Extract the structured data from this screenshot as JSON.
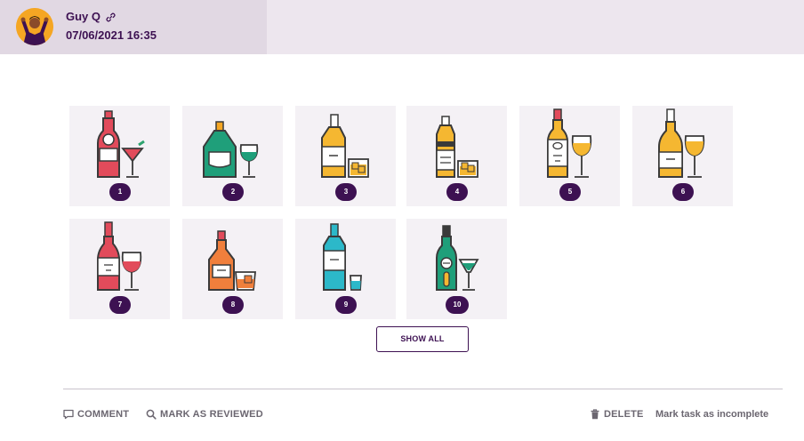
{
  "post": {
    "author": "Guy Q",
    "timestamp": "07/06/2021 16:35"
  },
  "gallery": {
    "items": [
      {
        "number": "1",
        "icon": "red-bottle-with-cocktail-glass-icon"
      },
      {
        "number": "2",
        "icon": "green-bottle-with-wine-glass-icon"
      },
      {
        "number": "3",
        "icon": "yellow-bottle-with-tumbler-icon"
      },
      {
        "number": "4",
        "icon": "whisky-bottle-with-tumbler-icon"
      },
      {
        "number": "5",
        "icon": "white-wine-bottle-with-glass-icon"
      },
      {
        "number": "6",
        "icon": "yellow-wine-bottle-with-glass-icon"
      },
      {
        "number": "7",
        "icon": "red-wine-bottle-with-glass-icon"
      },
      {
        "number": "8",
        "icon": "orange-bottle-with-tumbler-icon"
      },
      {
        "number": "9",
        "icon": "blue-bottle-with-shot-glass-icon"
      },
      {
        "number": "10",
        "icon": "green-bottle-with-cocktail-glass-icon"
      }
    ],
    "show_all_label": "SHOW ALL"
  },
  "actions": {
    "comment": "COMMENT",
    "mark_reviewed": "MARK AS REVIEWED",
    "delete": "DELETE",
    "mark_incomplete": "Mark task as incomplete"
  },
  "colors": {
    "brand": "#3d1152",
    "header_bg": "#ede6ee",
    "author_bg": "#e1d8e3",
    "tile_bg": "#f4f1f5",
    "muted_text": "#6b6670"
  }
}
